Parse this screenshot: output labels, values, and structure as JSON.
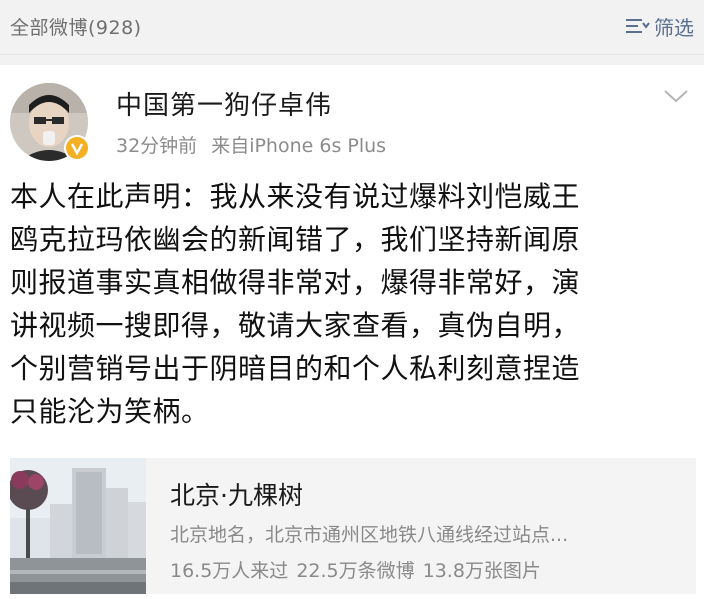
{
  "filter_bar": {
    "title": "全部微博(928)",
    "filter_label": "筛选",
    "filter_icon": "filter-lines-icon"
  },
  "post": {
    "author": "中国第一狗仔卓伟",
    "verified_badge_icon": "verified-v-badge-icon",
    "time": "32分钟前",
    "source": "来自iPhone 6s Plus",
    "menu_icon": "chevron-down-icon",
    "text_lines": [
      "本人在此声明：我从来没有说过爆料刘恺威王",
      "鸥克拉玛依幽会的新闻错了，我们坚持新闻原",
      "则报道事实真相做得非常对，爆得非常好，演",
      "讲视频一搜即得，敬请大家查看，真伪自明，",
      "个别营销号出于阴暗目的和个人私利刻意捏造",
      "只能沦为笑柄。"
    ]
  },
  "place": {
    "name": "北京·九棵树",
    "description": "北京地名，北京市通州区地铁八通线经过站点...",
    "stats": {
      "visitors": "16.5万人来过",
      "posts": "22.5万条微博",
      "photos": "13.8万张图片"
    }
  },
  "colors": {
    "filter_accent": "#5b6f8f",
    "badge": "#f3b023",
    "muted_text": "#8c8c8c",
    "card_bg": "#f4f4f4"
  }
}
